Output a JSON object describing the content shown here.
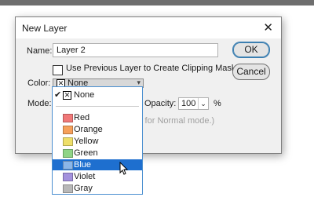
{
  "dialog": {
    "title": "New Layer",
    "name_label": "Name:",
    "name_value": "Layer 2",
    "clip_label": "Use Previous Layer to Create Clipping Mask",
    "clip_checked": false,
    "color_label": "Color:",
    "color_value": "None",
    "mode_label": "Mode:",
    "opacity_label": "Opacity:",
    "opacity_value": "100",
    "opacity_unit": "%",
    "hint_text": "s for Normal mode.)",
    "ok_label": "OK",
    "cancel_label": "Cancel"
  },
  "color_menu": {
    "selected": "None",
    "items": [
      {
        "label": "None",
        "color": "#ffffff"
      },
      {
        "label": "Red",
        "color": "#f07878"
      },
      {
        "label": "Orange",
        "color": "#f6a05a"
      },
      {
        "label": "Yellow",
        "color": "#eedf6a"
      },
      {
        "label": "Green",
        "color": "#8fd486"
      },
      {
        "label": "Blue",
        "color": "#8bb6e8"
      },
      {
        "label": "Violet",
        "color": "#a391dd"
      },
      {
        "label": "Gray",
        "color": "#b8b8b8"
      }
    ],
    "hovered": "Blue"
  }
}
